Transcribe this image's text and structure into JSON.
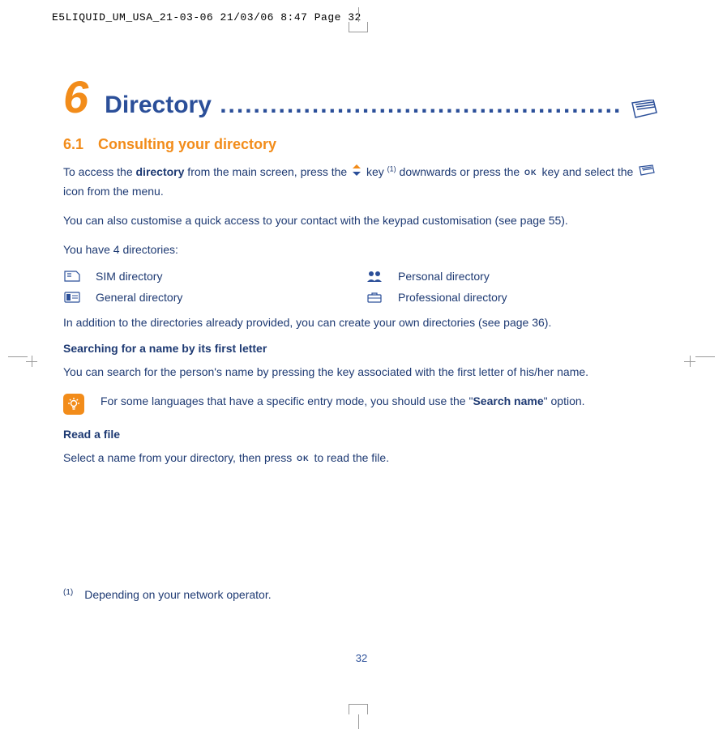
{
  "header": "E5LIQUID_UM_USA_21-03-06  21/03/06  8:47  Page 32",
  "chapter": {
    "num": "6",
    "title": "Directory",
    "dots": " ................................................"
  },
  "section": {
    "num": "6.1",
    "title": "Consulting your directory"
  },
  "p1a": "To access the ",
  "p1b": "directory",
  "p1c": " from the main screen, press the ",
  "p1d": " key ",
  "p1e": " downwards or press the ",
  "p1f": " key and select the ",
  "p1g": " icon from the menu.",
  "p2": "You can also customise a quick access to your contact with the keypad customisation (see page 55).",
  "p3": "You have 4 directories:",
  "dir": {
    "sim": "SIM directory",
    "personal": "Personal directory",
    "general": "General directory",
    "professional": "Professional directory"
  },
  "p4": "In addition to the directories already provided, you can create your own directories (see page 36).",
  "sub1": "Searching for a name by its first letter",
  "p5": "You can search for the person's name by pressing the key associated with the first letter of his/her name.",
  "note_a": "For some languages that have a specific entry mode, you should use the \"",
  "note_b": "Search name",
  "note_c": "\" option.",
  "sub2": "Read a file",
  "p6a": "Select a name from your directory, then press ",
  "p6b": " to read the file.",
  "fn_mark": "(1)",
  "fn_text": "Depending on your network operator.",
  "page_num": "32",
  "sup1": "(1)"
}
